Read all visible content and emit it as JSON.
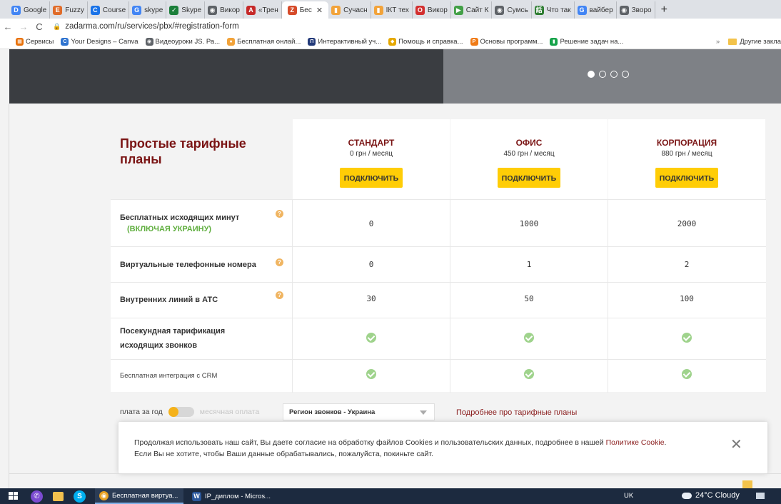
{
  "browser": {
    "tabs": [
      {
        "label": "Google",
        "icon": "google-docs-icon",
        "color": "#4285f4",
        "glyph": "D"
      },
      {
        "label": "Fuzzy",
        "icon": "e-letter-icon",
        "color": "#e06c2a",
        "glyph": "E"
      },
      {
        "label": "Course",
        "icon": "globe-icon",
        "color": "#1a73e8",
        "glyph": "C"
      },
      {
        "label": "skype",
        "icon": "google-icon",
        "color": "#4285f4",
        "glyph": "G"
      },
      {
        "label": "Skype",
        "icon": "check-icon",
        "color": "#1b7f3a",
        "glyph": "✓"
      },
      {
        "label": "Викор",
        "icon": "globe-icon",
        "color": "#5f6368",
        "glyph": "◉"
      },
      {
        "label": "«Трен",
        "icon": "a-letter-icon",
        "color": "#c62828",
        "glyph": "A"
      },
      {
        "label": "Бес",
        "icon": "zadarma-icon",
        "color": "#d64b2a",
        "glyph": "Z",
        "active": true
      },
      {
        "label": "Сучасн",
        "icon": "chart-icon",
        "color": "#f2a33a",
        "glyph": "▮"
      },
      {
        "label": "ІКТ тех",
        "icon": "chart-icon",
        "color": "#f2a33a",
        "glyph": "▮"
      },
      {
        "label": "Викор",
        "icon": "opera-icon",
        "color": "#d32f2f",
        "glyph": "O"
      },
      {
        "label": "Сайт К",
        "icon": "flag-icon",
        "color": "#43a047",
        "glyph": "▶"
      },
      {
        "label": "Сумсь",
        "icon": "globe-icon",
        "color": "#5f6368",
        "glyph": "◉"
      },
      {
        "label": "Что так",
        "icon": "hieroglyph-icon",
        "color": "#2e7d32",
        "glyph": "話"
      },
      {
        "label": "вайбер",
        "icon": "google-icon",
        "color": "#4285f4",
        "glyph": "G"
      },
      {
        "label": "Зворо",
        "icon": "globe-icon",
        "color": "#5f6368",
        "glyph": "◉"
      }
    ],
    "url": "zadarma.com/ru/services/pbx/#registration-form",
    "bookmarks": [
      {
        "label": "Сервисы",
        "color": "#e8710a",
        "glyph": "▦"
      },
      {
        "label": "Your Designs – Canva",
        "color": "#2f74d0",
        "glyph": "C"
      },
      {
        "label": "Видеоуроки JS. Ра...",
        "color": "#5f6368",
        "glyph": "◉"
      },
      {
        "label": "Бесплатная онлай...",
        "color": "#f2a33a",
        "glyph": "●"
      },
      {
        "label": "Интерактивный уч...",
        "color": "#233a7a",
        "glyph": "П"
      },
      {
        "label": "Помощь и справка...",
        "color": "#e5a800",
        "glyph": "◆"
      },
      {
        "label": "Основы программ...",
        "color": "#f07b16",
        "glyph": "Р"
      },
      {
        "label": "Решение задач на...",
        "color": "#16a34a",
        "glyph": "▮"
      }
    ],
    "bookmarks_more": "»",
    "other_bookmarks": "Другие закла"
  },
  "pricing": {
    "title": "Простые тарифные планы",
    "plans": [
      {
        "name": "СТАНДАРТ",
        "price": "0 грн / месяц",
        "button": "ПОДКЛЮЧИТЬ"
      },
      {
        "name": "ОФИС",
        "price": "450 грн / месяц",
        "button": "ПОДКЛЮЧИТЬ"
      },
      {
        "name": "КОРПОРАЦИЯ",
        "price": "880 грн / месяц",
        "button": "ПОДКЛЮЧИТЬ"
      }
    ],
    "rows": [
      {
        "label": "Бесплатных исходящих минут",
        "sublabel": "(ВКЛЮЧАЯ УКРАИНУ)",
        "values": [
          "0",
          "1000",
          "2000"
        ]
      },
      {
        "label": "Виртуальные телефонные номера",
        "values": [
          "0",
          "1",
          "2"
        ]
      },
      {
        "label": "Внутренних линий в АТС",
        "values": [
          "30",
          "50",
          "100"
        ]
      },
      {
        "label": "Посекундная тарификация исходящих звонков",
        "values": [
          "check",
          "check",
          "check"
        ]
      },
      {
        "label": "Бесплатная интеграция с CRM",
        "values": [
          "check",
          "check",
          "check"
        ]
      }
    ],
    "billing_yearly": "плата за год",
    "billing_monthly": "месячная оплата",
    "region_select": "Регион звонков - Украина",
    "more_link": "Подробнее про тарифные планы"
  },
  "cookie": {
    "text_1": "Продолжая использовать наш сайт, Вы даете согласие на обработку файлов Cookies и пользовательских данных, подробнее в нашей ",
    "link": "Политике Cookie",
    "text_2": ".",
    "text_3": "Если Вы не хотите, чтобы Ваши данные обрабатывались, пожалуйста, покиньте сайт.",
    "close_glyph": "✕"
  },
  "taskbar": {
    "apps": [
      {
        "label": "Бесплатная виртуа...",
        "color": "#e8a020",
        "glyph": "◉"
      },
      {
        "label": "IP_диплом - Micros...",
        "color": "#2b579a",
        "glyph": "W"
      }
    ],
    "lang": "UK",
    "weather": "24°C  Cloudy"
  },
  "colors": {
    "accent": "#7a1414",
    "button": "#ffcd06",
    "check": "#9fd38c",
    "help": "#f0b562",
    "green_text": "#5fae3e"
  }
}
